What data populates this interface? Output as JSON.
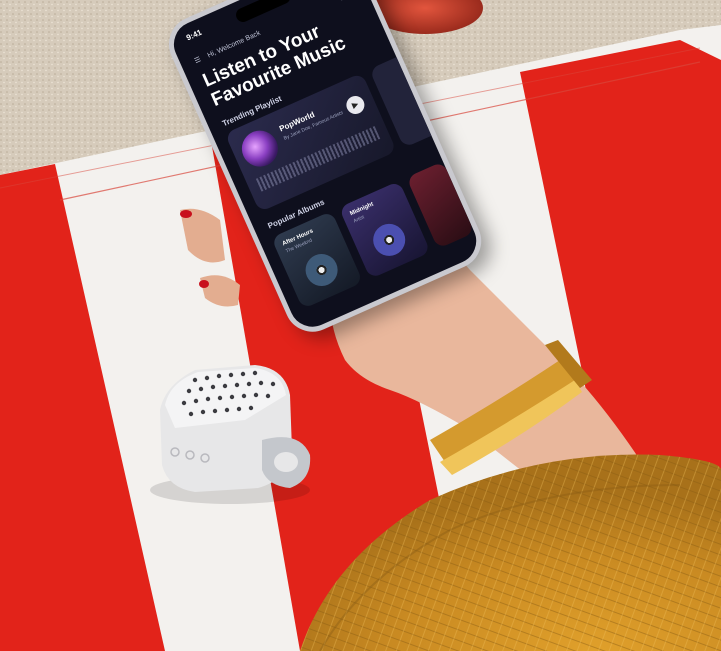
{
  "scene": {
    "description_items": [
      "beach-towel",
      "smartphone",
      "hand",
      "gold-bracelet",
      "portable-speaker",
      "straw-hat",
      "sand",
      "glass"
    ]
  },
  "phone": {
    "time": "9:41",
    "greeting": "Hi, Welcome Back",
    "headline": "Listen to Your Favourite Music",
    "trending_label": "Trending Playlist",
    "playlist": {
      "name": "PopWorld",
      "subtitle": "By Jane Doe, Famous Artists"
    },
    "popular_label": "Popular Albums",
    "albums": [
      {
        "name": "After Hours",
        "subtitle": "The Weeknd"
      },
      {
        "name": "Midnight",
        "subtitle": "Artist"
      }
    ],
    "colors": {
      "screen": "#0e0f1d",
      "accent": "#8a3fc2"
    }
  }
}
